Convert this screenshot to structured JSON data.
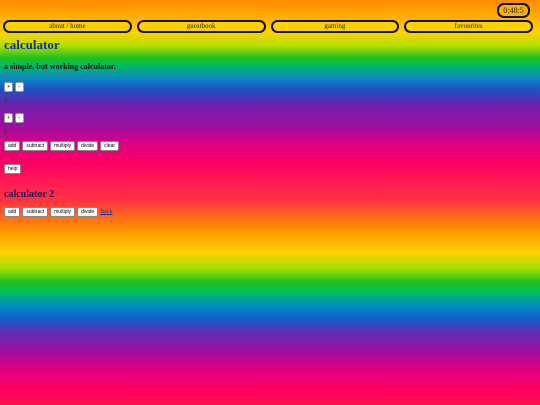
{
  "clock": {
    "time": "0:48:5"
  },
  "nav": {
    "items": [
      {
        "label": "about / home"
      },
      {
        "label": "guestbook"
      },
      {
        "label": "gaming"
      },
      {
        "label": "favourites"
      }
    ]
  },
  "calc1": {
    "title": "calculator",
    "subtitle": "a simple, but working calculator.",
    "num1": {
      "up": "+",
      "down": "−",
      "value": "0"
    },
    "num2": {
      "up": "+",
      "down": "−",
      "value": "0"
    },
    "ops": [
      "add",
      "subtract",
      "multiply",
      "divide",
      "clear"
    ],
    "help": "help"
  },
  "calc2": {
    "title": "calculator 2",
    "ops": [
      "add",
      "subtract",
      "multiply",
      "divide"
    ],
    "link": "Back"
  }
}
